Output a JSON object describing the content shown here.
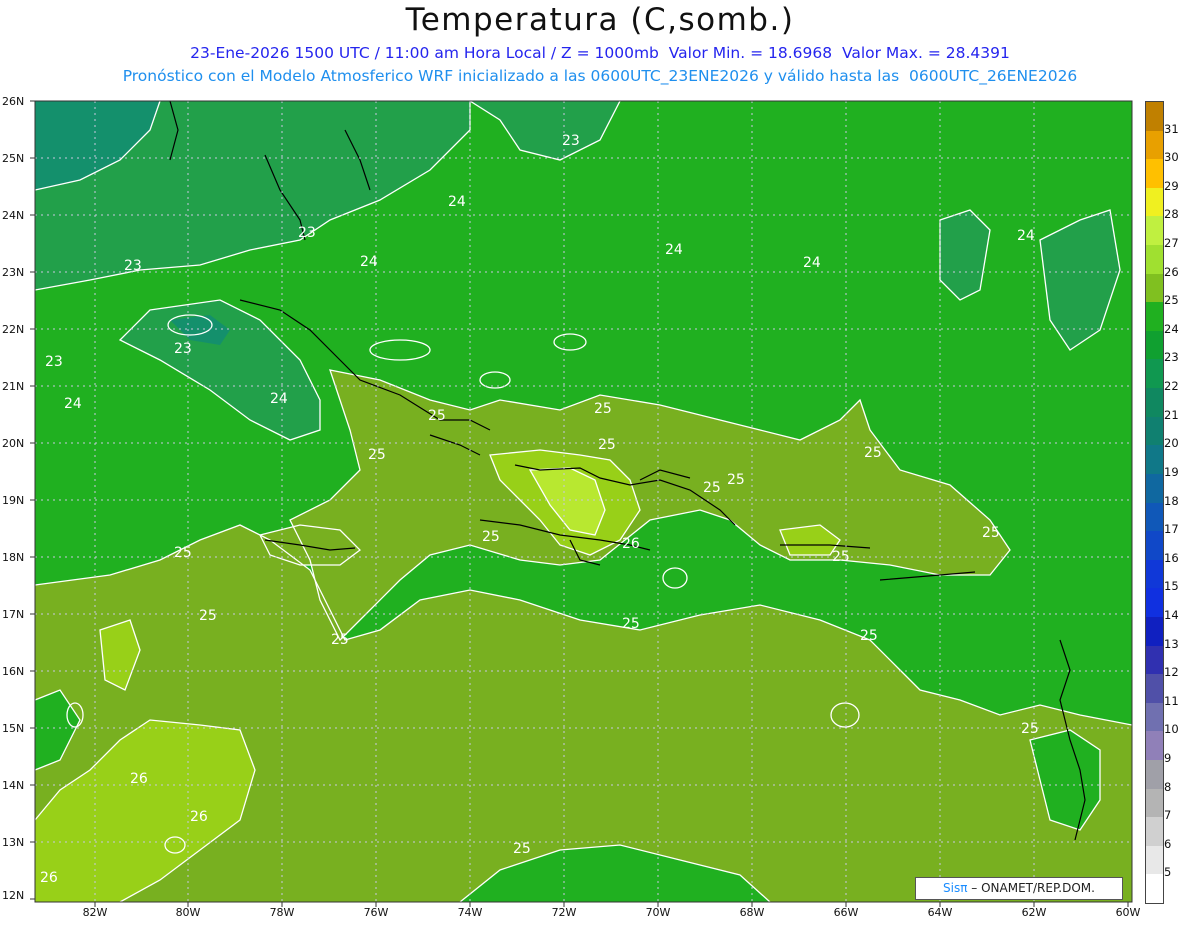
{
  "header": {
    "title": "Temperatura (C,somb.)",
    "line1": "23-Ene-2026 1500 UTC / 11:00 am Hora Local / Z = 1000mb  Valor Min. = 18.6968  Valor Max. = 28.4391",
    "line2": "Pronóstico con el Modelo Atmosferico WRF inicializado a las 0600UTC_23ENE2026 y válido hasta las  0600UTC_26ENE2026"
  },
  "axes": {
    "lat_labels": [
      "26N",
      "25N",
      "24N",
      "23N",
      "22N",
      "21N",
      "20N",
      "19N",
      "18N",
      "17N",
      "16N",
      "15N",
      "14N",
      "13N",
      "12N"
    ],
    "lon_labels": [
      "82W",
      "80W",
      "78W",
      "76W",
      "74W",
      "72W",
      "70W",
      "68W",
      "66W",
      "64W",
      "62W",
      "60W"
    ]
  },
  "legend": {
    "ticks": [
      "31",
      "30",
      "29",
      "28",
      "27",
      "26",
      "25",
      "24",
      "23",
      "22",
      "21",
      "20",
      "19",
      "18",
      "17",
      "16",
      "15",
      "14",
      "13",
      "12",
      "11",
      "10",
      "9",
      "8",
      "7",
      "6",
      "5"
    ],
    "colors": [
      "#c08000",
      "#e8a000",
      "#ffc000",
      "#f0f020",
      "#c0f040",
      "#a0e030",
      "#80c020",
      "#20b020",
      "#10a030",
      "#109850",
      "#108860",
      "#108070",
      "#107888",
      "#1068a0",
      "#1058b8",
      "#1048c8",
      "#1038d8",
      "#1030e0",
      "#1020c0",
      "#3030b0",
      "#5050a8",
      "#7070b0",
      "#9080b8",
      "#a0a0a8",
      "#b4b4b4",
      "#d0d0d0",
      "#e8e8e8",
      "#ffffff"
    ]
  },
  "contour_labels": [
    "23",
    "23",
    "24",
    "23",
    "24",
    "24",
    "24",
    "24",
    "23",
    "23",
    "24",
    "24",
    "25",
    "25",
    "25",
    "25",
    "25",
    "25",
    "26",
    "25",
    "25",
    "25",
    "25",
    "25",
    "25",
    "25",
    "25",
    "25",
    "25",
    "26",
    "26",
    "26",
    "25"
  ],
  "colors": {
    "temp_23": "#20a048",
    "temp_24": "#20b020",
    "temp_25": "#78b020",
    "temp_26": "#98d018",
    "temp_27": "#b8e830",
    "temp_22": "#139870",
    "coast": "#000000",
    "contour": "#ffffff"
  },
  "credit": {
    "brand": "Sisπ",
    "org": "– ONAMET/REP.DOM."
  }
}
